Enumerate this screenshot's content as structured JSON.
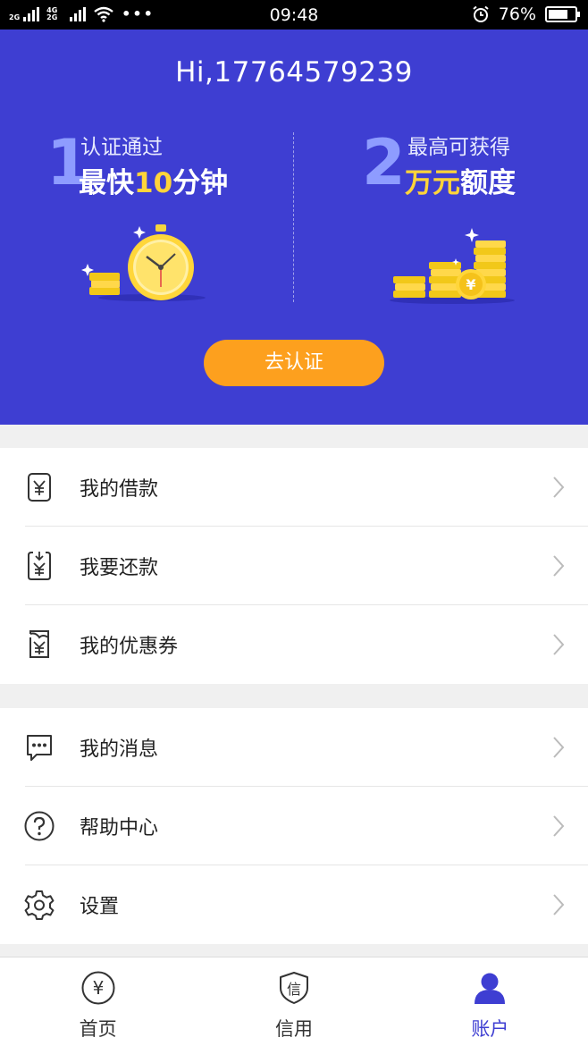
{
  "status_bar": {
    "net1": "2G",
    "net2": "4G 2G",
    "dots": "•••",
    "time": "09:48",
    "battery": "76%",
    "battery_level": 0.76
  },
  "banner": {
    "greeting": "Hi,17764579239",
    "step1": {
      "num": "1",
      "line1": "认证通过",
      "line2_pre": "最快",
      "line2_hl": "10",
      "line2_post": "分钟"
    },
    "step2": {
      "num": "2",
      "line1": "最高可获得",
      "line2_hl": "万元",
      "line2_post": "额度"
    },
    "cta": "去认证",
    "colors": {
      "bg": "#3e3ed2",
      "cta": "#fda01e",
      "highlight": "#ffd43a"
    }
  },
  "menu": {
    "group1": [
      {
        "label": "我的借款",
        "icon": "loan-icon"
      },
      {
        "label": "我要还款",
        "icon": "repay-icon"
      },
      {
        "label": "我的优惠券",
        "icon": "coupon-icon"
      }
    ],
    "group2": [
      {
        "label": "我的消息",
        "icon": "message-icon"
      },
      {
        "label": "帮助中心",
        "icon": "help-icon"
      },
      {
        "label": "设置",
        "icon": "gear-icon"
      }
    ]
  },
  "tabbar": {
    "tabs": [
      {
        "label": "首页",
        "icon": "yuan-circle-icon",
        "active": false
      },
      {
        "label": "信用",
        "icon": "credit-shield-icon",
        "active": false
      },
      {
        "label": "账户",
        "icon": "user-icon",
        "active": true
      }
    ],
    "icon_text": {
      "home": "¥",
      "credit": "信"
    }
  }
}
